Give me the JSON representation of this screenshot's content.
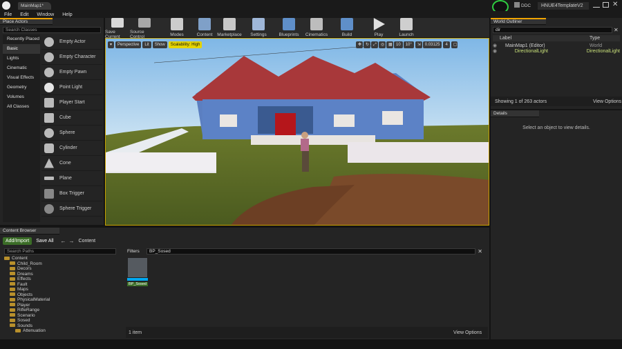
{
  "window": {
    "tab_title": "MainMap1*",
    "ddc_label": "DDC",
    "project_name": "HNUE4TemplateV2"
  },
  "menu": [
    "File",
    "Edit",
    "Window",
    "Help"
  ],
  "place_actors": {
    "tab_label": "Place Actors",
    "search_placeholder": "Search Classes",
    "categories": [
      "Recently Placed",
      "Basic",
      "Lights",
      "Cinematic",
      "Visual Effects",
      "Geometry",
      "Volumes",
      "All Classes"
    ],
    "items": [
      "Empty Actor",
      "Empty Character",
      "Empty Pawn",
      "Point Light",
      "Player Start",
      "Cube",
      "Sphere",
      "Cylinder",
      "Cone",
      "Plane",
      "Box Trigger",
      "Sphere Trigger"
    ]
  },
  "toolbar": [
    "Save Current",
    "Source Control",
    "Modes",
    "Content",
    "Marketplace",
    "Settings",
    "Blueprints",
    "Cinematics",
    "Build",
    "Play",
    "Launch"
  ],
  "viewport": {
    "perspective": "Perspective",
    "lit": "Lit",
    "show": "Show",
    "scalability": "Scalability: High",
    "snap_grid": "10",
    "snap_angle": "10°",
    "snap_scale": "0.03125",
    "camera_speed": "4"
  },
  "outliner": {
    "tab_label": "World Outliner",
    "search_value": "dir",
    "col_label": "Label",
    "col_type": "Type",
    "rows": [
      {
        "label": "MainMap1 (Editor)",
        "type": "World"
      },
      {
        "label": "DirectionalLight",
        "type": "DirectionalLight"
      }
    ],
    "status": "Showing 1 of 263 actors",
    "view_options": "View Options"
  },
  "details": {
    "tab_label": "Details",
    "empty_text": "Select an object to view details."
  },
  "content_browser": {
    "tab_label": "Content Browser",
    "add_import": "Add/Import",
    "save_all": "Save All",
    "path_root": "Content",
    "search_paths_placeholder": "Search Paths",
    "filters_label": "Filters",
    "filter_search_value": "BP_Sosed",
    "tree": [
      "Content",
      "Child_Room",
      "Decors",
      "Dreams",
      "Effects",
      "Fault",
      "Maps",
      "Objects",
      "PhysicalMaterial",
      "Player",
      "RifleRange",
      "Scenario",
      "Sosed",
      "Sounds",
      "Attenuation"
    ],
    "asset_name": "BP_Sosed",
    "item_count": "1 item",
    "view_options": "View Options"
  },
  "colors": {
    "accent": "#f0a500",
    "green": "#3b6d27",
    "panel": "#242424"
  }
}
